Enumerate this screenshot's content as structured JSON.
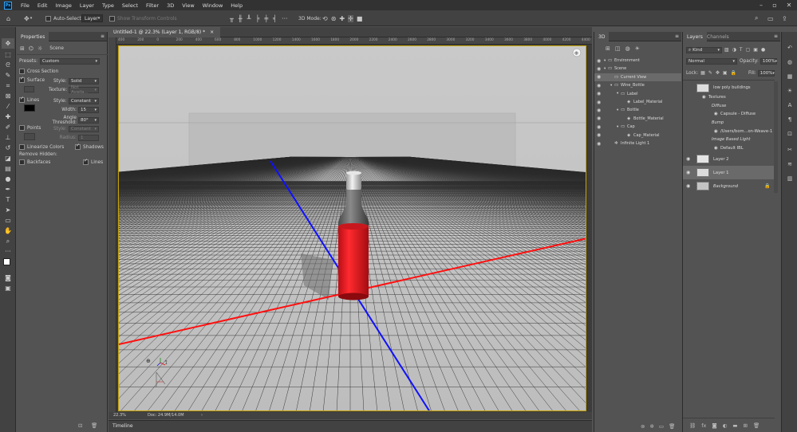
{
  "app": {
    "logo": "Ps"
  },
  "menu": [
    "File",
    "Edit",
    "Image",
    "Layer",
    "Type",
    "Select",
    "Filter",
    "3D",
    "View",
    "Window",
    "Help"
  ],
  "options_bar": {
    "auto_select_label": "Auto-Select:",
    "auto_select_value": "Layer",
    "show_transform_label": "Show Transform Controls",
    "mode_3d_label": "3D Mode:"
  },
  "properties": {
    "tab_title": "Properties",
    "scene_label": "Scene",
    "presets_label": "Presets:",
    "presets_value": "Custom",
    "cross_section_label": "Cross Section",
    "surface_label": "Surface",
    "surface_style_label": "Style:",
    "surface_style_value": "Solid",
    "texture_label": "Texture:",
    "texture_value": "Not Availa...",
    "lines_label": "Lines",
    "lines_style_label": "Style:",
    "lines_style_value": "Constant",
    "width_label": "Width:",
    "width_value": "15",
    "angle_label": "Angle Threshold:",
    "angle_value": "80°",
    "points_label": "Points",
    "points_style_label": "Style:",
    "points_style_value": "Constant",
    "radius_label": "Radius:",
    "radius_value": "1",
    "linearize_label": "Linearize Colors",
    "shadows_label": "Shadows",
    "remove_hidden_label": "Remove Hidden:",
    "backfaces_label": "Backfaces",
    "lines2_label": "Lines"
  },
  "document": {
    "tab_title": "Untitled-1 @ 22.3% (Layer 1, RGB/8) *",
    "zoom": "22.3%",
    "doc_info": "Doc: 24.9M/14.0M",
    "ruler_ticks": [
      "400",
      "200",
      "0",
      "200",
      "400",
      "600",
      "800",
      "1000",
      "1200",
      "1400",
      "1600",
      "1800",
      "2000",
      "2200",
      "2400",
      "2600",
      "2800",
      "3000",
      "3200",
      "3400",
      "3600",
      "3800",
      "4000",
      "4200",
      "4400"
    ]
  },
  "timeline": {
    "label": "Timeline"
  },
  "panel_3d": {
    "title": "3D",
    "items": [
      {
        "label": "Environment",
        "indent": 0
      },
      {
        "label": "Scene",
        "indent": 0
      },
      {
        "label": "Current View",
        "indent": 1
      },
      {
        "label": "Wine_Bottle",
        "indent": 1
      },
      {
        "label": "Label",
        "indent": 2
      },
      {
        "label": "Label_Material",
        "indent": 3
      },
      {
        "label": "Bottle",
        "indent": 2
      },
      {
        "label": "Bottle_Material",
        "indent": 3
      },
      {
        "label": "Cap",
        "indent": 2
      },
      {
        "label": "Cap_Material",
        "indent": 3
      },
      {
        "label": "Infinite Light 1",
        "indent": 1
      }
    ]
  },
  "layers": {
    "tab_layers": "Layers",
    "tab_channels": "Channels",
    "kind_label": "Kind",
    "blend_mode": "Normal",
    "opacity_label": "Opacity:",
    "opacity_value": "100%",
    "lock_label": "Lock:",
    "fill_label": "Fill:",
    "fill_value": "100%",
    "list": [
      {
        "name": "low poly buildings",
        "type": "3d"
      },
      {
        "name": "Textures",
        "type": "sub"
      },
      {
        "name": "Diffuse",
        "type": "subitalic"
      },
      {
        "name": "Capsule - Diffuse",
        "type": "subsub"
      },
      {
        "name": "Bump",
        "type": "subitalic"
      },
      {
        "name": "/Users/bom...on-Weave-1",
        "type": "subsub"
      },
      {
        "name": "Image Based Light",
        "type": "subitalic"
      },
      {
        "name": "Default IBL",
        "type": "subsub"
      },
      {
        "name": "Layer 2",
        "type": "layer"
      },
      {
        "name": "Layer 1",
        "type": "layer3d"
      },
      {
        "name": "Background",
        "type": "bg"
      }
    ]
  },
  "colors": {
    "bottle": "#e8141c",
    "x_axis": "#ff1a1a",
    "z_axis": "#1a1aff",
    "canvas_bg": "#c4c4c4",
    "accent_border": "#c8a300"
  }
}
